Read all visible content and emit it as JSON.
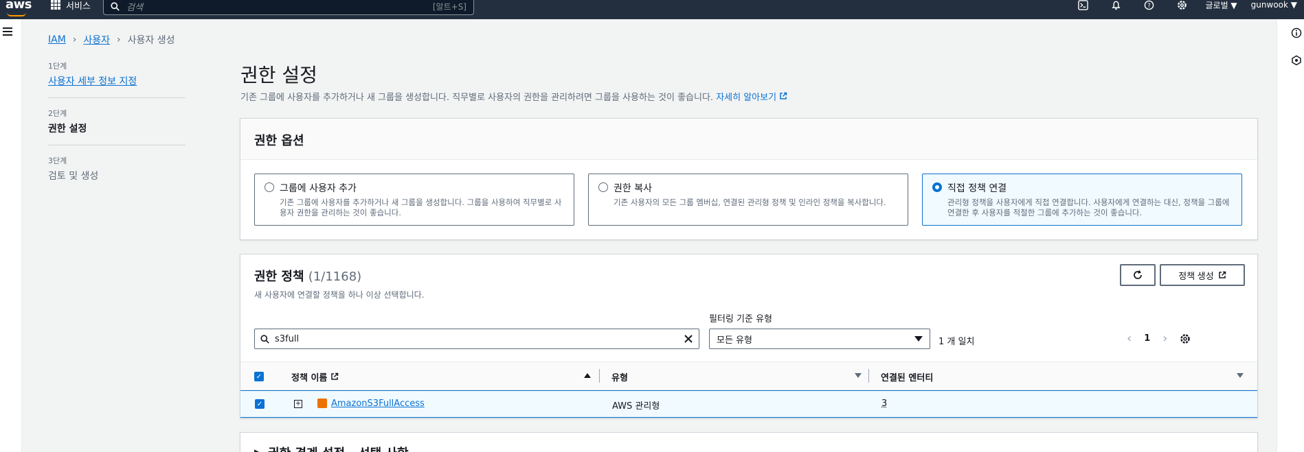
{
  "topnav": {
    "logo": "aws",
    "services": "서비스",
    "search_placeholder": "검색",
    "search_shortcut": "[알트+S]",
    "region": "글로벌 ▼",
    "user": "gunwook ▼"
  },
  "breadcrumb": {
    "items": [
      "IAM",
      "사용자",
      "사용자 생성"
    ]
  },
  "steps": [
    {
      "num": "1단계",
      "title": "사용자 세부 정보 지정"
    },
    {
      "num": "2단계",
      "title": "권한 설정"
    },
    {
      "num": "3단계",
      "title": "검토 및 생성"
    }
  ],
  "page": {
    "title": "권한 설정",
    "description": "기존 그룹에 사용자를 추가하거나 새 그룹을 생성합니다. 직무별로 사용자의 권한을 관리하려면 그룹을 사용하는 것이 좋습니다.",
    "learn_more": "자세히 알아보기"
  },
  "options": {
    "header": "권한 옵션",
    "tiles": [
      {
        "title": "그룹에 사용자 추가",
        "desc": "기존 그룹에 사용자를 추가하거나 새 그룹을 생성합니다. 그룹을 사용하여 직무별로 사용자 권한을 관리하는 것이 좋습니다."
      },
      {
        "title": "권한 복사",
        "desc": "기존 사용자의 모든 그룹 멤버십, 연결된 관리형 정책 및 인라인 정책을 복사합니다."
      },
      {
        "title": "직접 정책 연결",
        "desc": "관리형 정책을 사용자에게 직접 연결합니다. 사용자에게 연결하는 대신, 정책을 그룹에 연결한 후 사용자를 적절한 그룹에 추가하는 것이 좋습니다."
      }
    ],
    "selected_index": 2
  },
  "policies": {
    "title": "권한 정책",
    "count": "(1/1168)",
    "subtitle": "새 사용자에 연결할 정책을 하나 이상 선택합니다.",
    "create_button": "정책 생성",
    "filter_label": "필터링 기준 유형",
    "search_value": "s3full",
    "type_select": "모든 유형",
    "match": "1 개 일치",
    "page": "1",
    "columns": [
      "정책 이름",
      "유형",
      "연결된 엔터티"
    ],
    "rows": [
      {
        "name": "AmazonS3FullAccess",
        "type": "AWS 관리형",
        "entities": "3"
      }
    ]
  },
  "boundary": {
    "title": "▶ 권한 경계 설정 - 선택 사항"
  },
  "colors": {
    "nav_bg": "#232f3e",
    "link": "#0972d3",
    "selected_bg": "#f1faff"
  }
}
